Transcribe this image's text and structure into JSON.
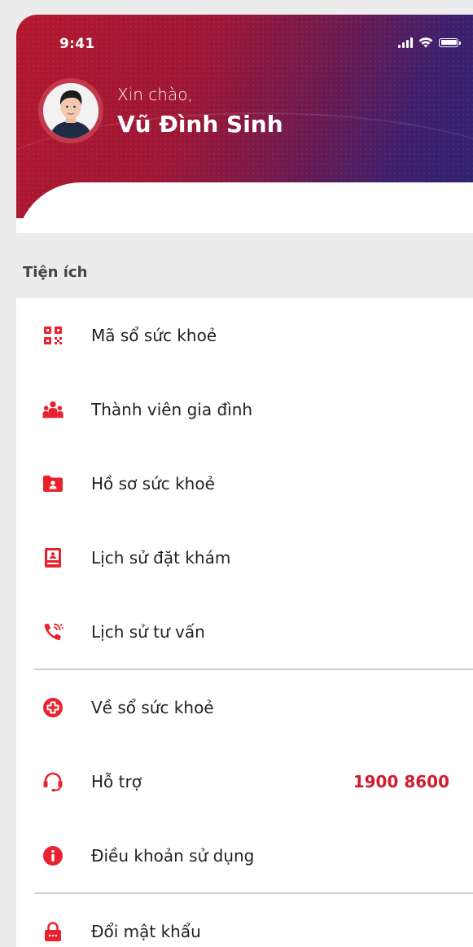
{
  "status_bar": {
    "time": "9:41"
  },
  "profile": {
    "greeting": "Xin chào,",
    "name": "Vũ Đình Sinh"
  },
  "section": {
    "title": "Tiện ích"
  },
  "menu_group_1": [
    {
      "label": "Mã sổ sức khoẻ",
      "icon": "qr-code-icon"
    },
    {
      "label": "Thành viên gia đình",
      "icon": "family-icon"
    },
    {
      "label": "Hồ sơ sức khoẻ",
      "icon": "health-folder-icon"
    },
    {
      "label": "Lịch sử đặt khám",
      "icon": "booking-book-icon"
    },
    {
      "label": "Lịch sử tư vấn",
      "icon": "phone-call-icon"
    }
  ],
  "menu_group_2": [
    {
      "label": "Về sổ sức khoẻ",
      "icon": "medical-cross-icon"
    },
    {
      "label": "Hỗ trợ",
      "icon": "headset-icon",
      "value": "1900 8600"
    },
    {
      "label": "Điều khoản sử dụng",
      "icon": "info-icon"
    }
  ],
  "menu_group_3": [
    {
      "label": "Đổi mật khẩu",
      "icon": "lock-icon"
    }
  ],
  "colors": {
    "accent": "#e8232f",
    "hotline": "#d11c2e",
    "header_start": "#b3182d",
    "header_end": "#2f2270"
  }
}
